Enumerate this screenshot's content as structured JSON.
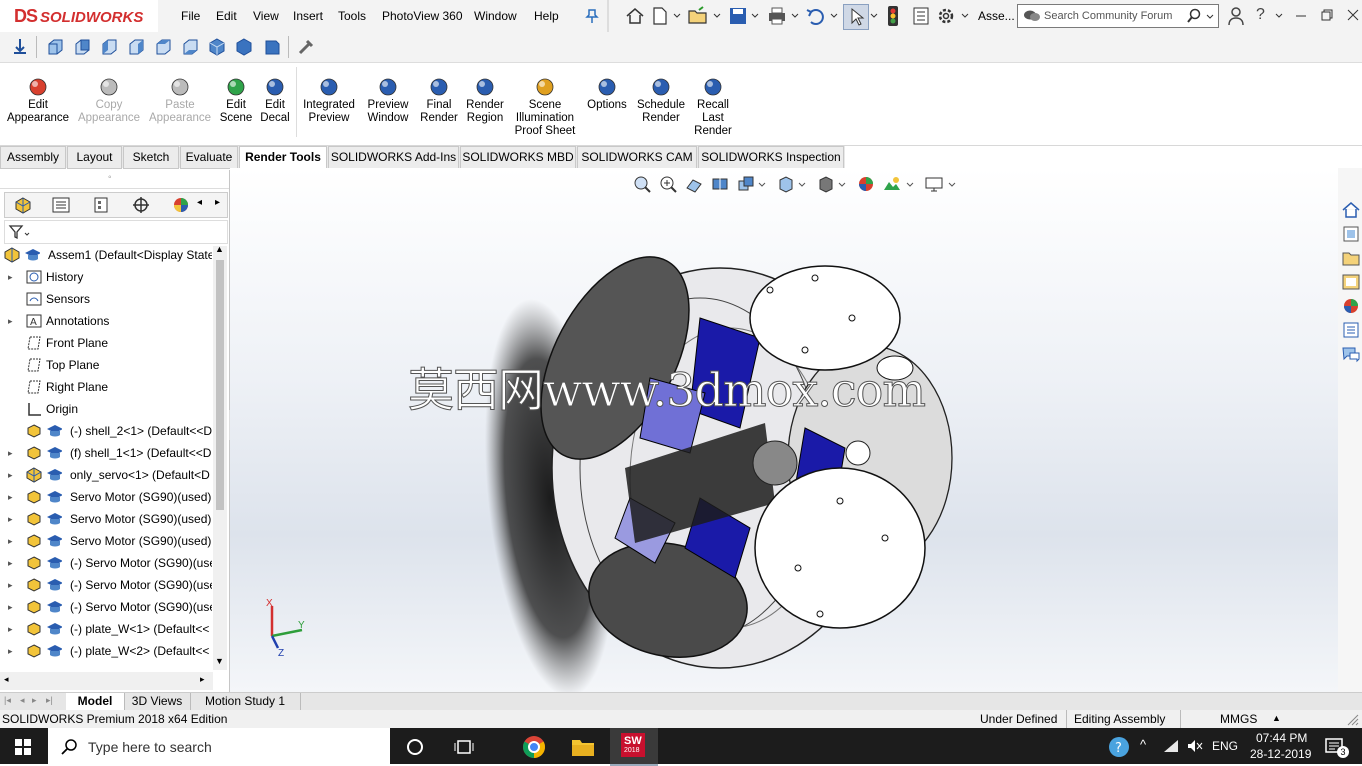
{
  "app": {
    "logo_ds": "DS",
    "logo_text": "SOLIDWORKS",
    "doc_short": "Asse..."
  },
  "menu": [
    "File",
    "Edit",
    "View",
    "Insert",
    "Tools",
    "PhotoView 360",
    "Window",
    "Help"
  ],
  "search": {
    "placeholder": "Search Community Forum"
  },
  "ribbon": {
    "buttons": [
      {
        "label": "Edit\nAppearance",
        "disabled": false
      },
      {
        "label": "Copy\nAppearance",
        "disabled": true
      },
      {
        "label": "Paste\nAppearance",
        "disabled": true
      },
      {
        "label": "Edit\nScene",
        "disabled": false
      },
      {
        "label": "Edit\nDecal",
        "disabled": false
      },
      {
        "label": "Integrated\nPreview",
        "disabled": false
      },
      {
        "label": "Preview\nWindow",
        "disabled": false
      },
      {
        "label": "Final\nRender",
        "disabled": false
      },
      {
        "label": "Render\nRegion",
        "disabled": false
      },
      {
        "label": "Scene\nIllumination\nProof Sheet",
        "disabled": false
      },
      {
        "label": "Options",
        "disabled": false
      },
      {
        "label": "Schedule\nRender",
        "disabled": false
      },
      {
        "label": "Recall\nLast\nRender",
        "disabled": false
      }
    ]
  },
  "tabs": [
    {
      "label": "Assembly",
      "active": false
    },
    {
      "label": "Layout",
      "active": false
    },
    {
      "label": "Sketch",
      "active": false
    },
    {
      "label": "Evaluate",
      "active": false
    },
    {
      "label": "Render Tools",
      "active": true
    },
    {
      "label": "SOLIDWORKS Add-Ins",
      "active": false
    },
    {
      "label": "SOLIDWORKS MBD",
      "active": false
    },
    {
      "label": "SOLIDWORKS CAM",
      "active": false
    },
    {
      "label": "SOLIDWORKS Inspection",
      "active": false
    }
  ],
  "tree": [
    {
      "label": "Assem1  (Default<Display State",
      "icon": "assembly-icon",
      "expander": false,
      "indent": 0
    },
    {
      "label": "History",
      "icon": "history-icon",
      "expander": true,
      "indent": 1
    },
    {
      "label": "Sensors",
      "icon": "sensors-icon",
      "expander": false,
      "indent": 1
    },
    {
      "label": "Annotations",
      "icon": "annotations-icon",
      "expander": true,
      "indent": 1
    },
    {
      "label": "Front Plane",
      "icon": "plane-icon",
      "expander": false,
      "indent": 1
    },
    {
      "label": "Top Plane",
      "icon": "plane-icon",
      "expander": false,
      "indent": 1
    },
    {
      "label": "Right Plane",
      "icon": "plane-icon",
      "expander": false,
      "indent": 1
    },
    {
      "label": "Origin",
      "icon": "origin-icon",
      "expander": false,
      "indent": 1
    },
    {
      "label": "(-) shell_2<1> (Default<<D",
      "icon": "part-icon",
      "expander": false,
      "indent": 1
    },
    {
      "label": "(f) shell_1<1> (Default<<D",
      "icon": "part-icon",
      "expander": true,
      "indent": 1
    },
    {
      "label": "only_servo<1> (Default<D",
      "icon": "subassembly-icon",
      "expander": true,
      "indent": 1
    },
    {
      "label": "Servo Motor (SG90)(used)",
      "icon": "part-icon",
      "expander": true,
      "indent": 1
    },
    {
      "label": "Servo Motor (SG90)(used)",
      "icon": "part-icon",
      "expander": true,
      "indent": 1
    },
    {
      "label": "Servo Motor (SG90)(used)",
      "icon": "part-icon",
      "expander": true,
      "indent": 1
    },
    {
      "label": "(-) Servo Motor (SG90)(use",
      "icon": "part-icon",
      "expander": true,
      "indent": 1
    },
    {
      "label": "(-) Servo Motor (SG90)(use",
      "icon": "part-icon",
      "expander": true,
      "indent": 1
    },
    {
      "label": "(-) Servo Motor (SG90)(use",
      "icon": "part-icon",
      "expander": true,
      "indent": 1
    },
    {
      "label": "(-) plate_W<1> (Default<<",
      "icon": "part-icon",
      "expander": true,
      "indent": 1
    },
    {
      "label": "(-) plate_W<2> (Default<<",
      "icon": "part-icon",
      "expander": true,
      "indent": 1
    }
  ],
  "watermark": "莫西网www.3dmox.com",
  "triad": {
    "x": "X",
    "y": "Y",
    "z": "Z"
  },
  "bottom_tabs": [
    "Model",
    "3D Views",
    "Motion Study 1"
  ],
  "status": {
    "edition": "SOLIDWORKS Premium 2018 x64 Edition",
    "state": "Under Defined",
    "mode": "Editing Assembly",
    "units": "MMGS"
  },
  "taskbar": {
    "search_placeholder": "Type here to search",
    "lang": "ENG",
    "time": "07:44 PM",
    "date": "28-12-2019",
    "notifications": "3",
    "sw_badge": "2018"
  },
  "colors": {
    "brand_red": "#d32f2f",
    "servo_blue": "#1a1aa8",
    "taskbar": "#1c1c1c"
  }
}
